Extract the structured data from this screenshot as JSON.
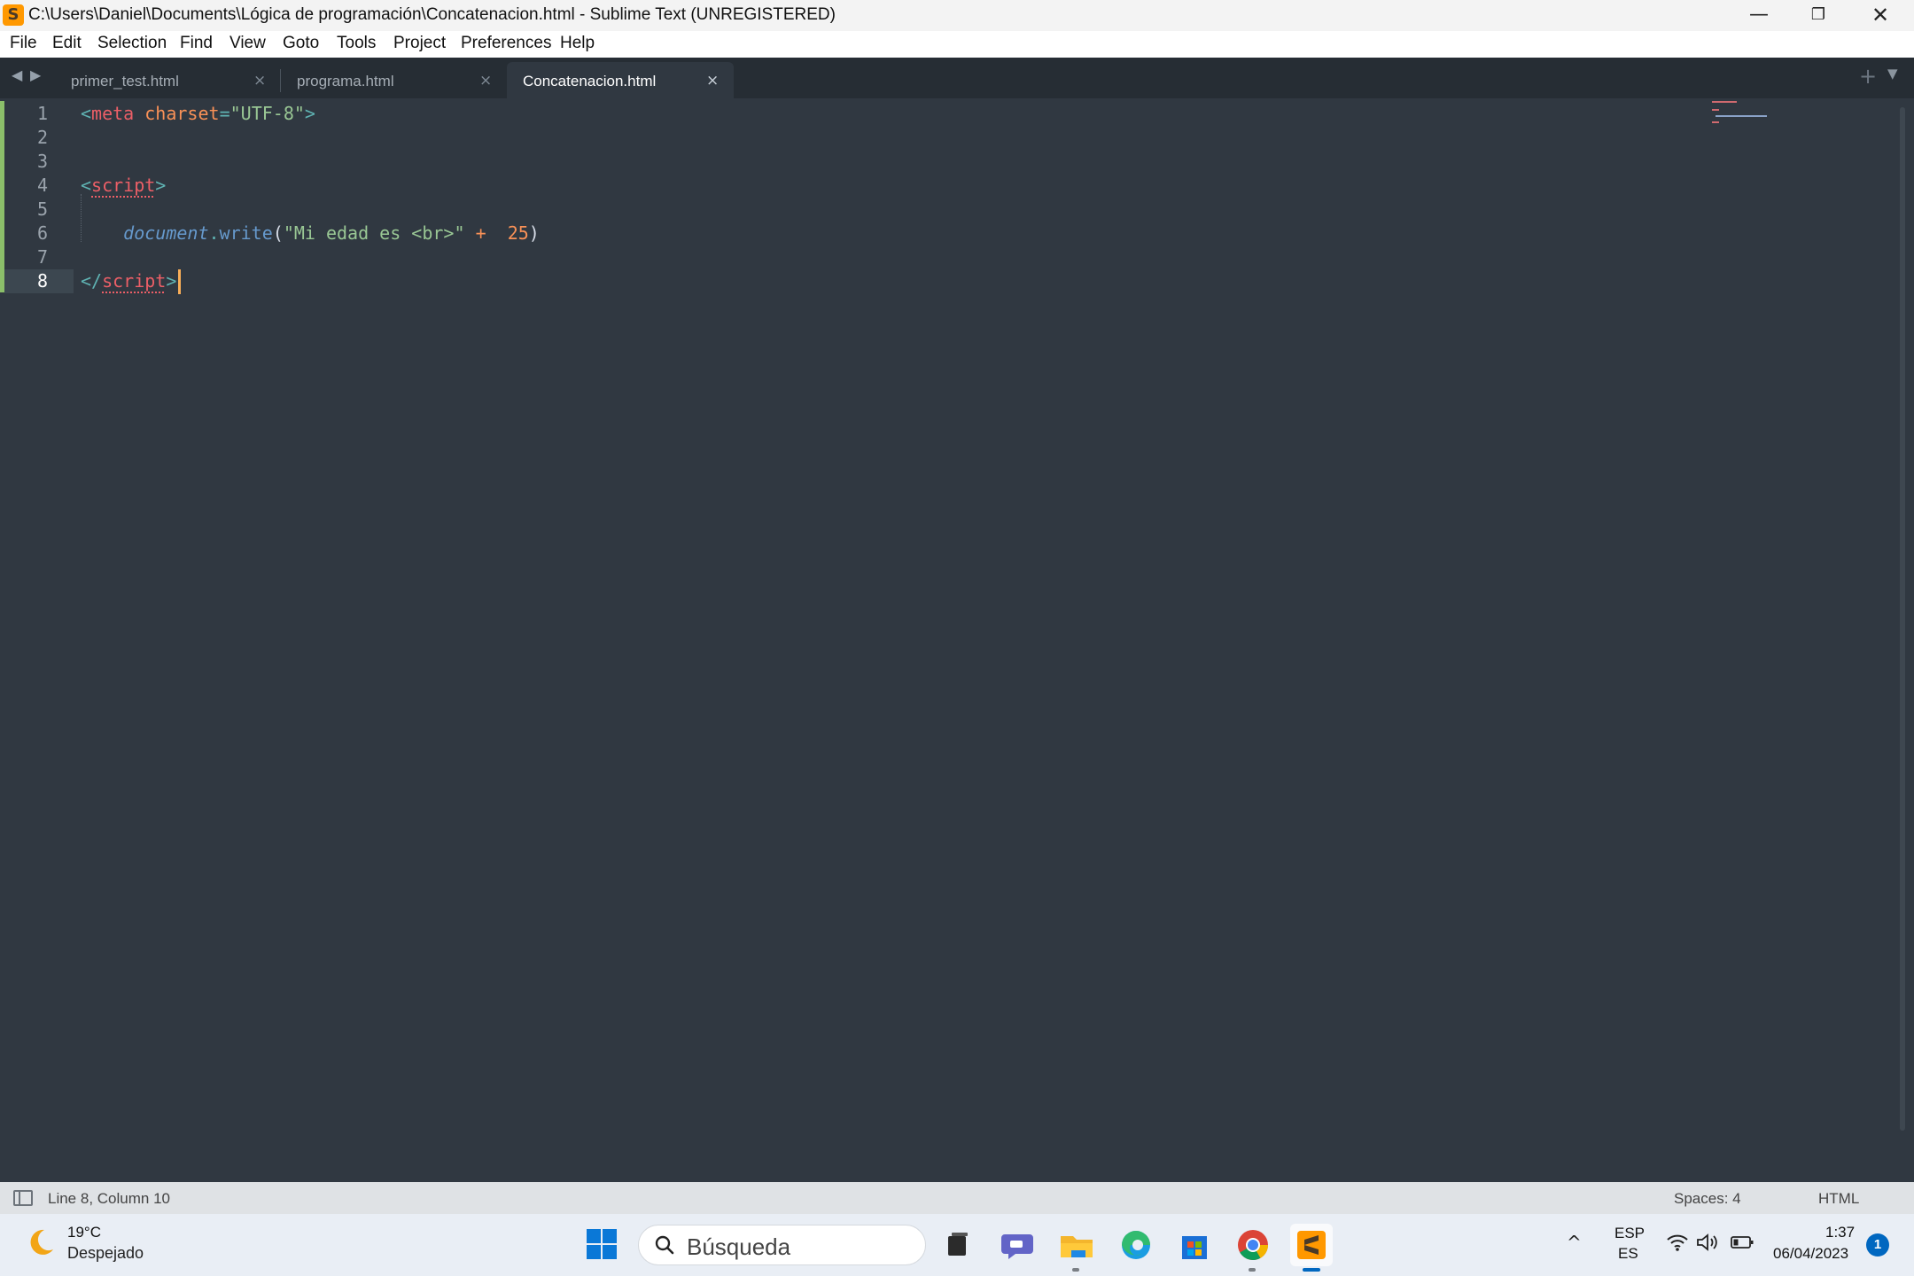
{
  "window": {
    "title": "C:\\Users\\Daniel\\Documents\\Lógica de programación\\Concatenacion.html - Sublime Text (UNREGISTERED)",
    "app_icon": "sublime-text-icon",
    "controls": {
      "minimize": "—",
      "maximize": "❐",
      "close": "✕"
    }
  },
  "menubar": {
    "items": [
      "File",
      "Edit",
      "Selection",
      "Find",
      "View",
      "Goto",
      "Tools",
      "Project",
      "Preferences",
      "Help"
    ]
  },
  "tabs": {
    "nav_back": "◀",
    "nav_forward": "▶",
    "items": [
      {
        "label": "primer_test.html",
        "active": false,
        "close": "×"
      },
      {
        "label": "programa.html",
        "active": false,
        "close": "×"
      },
      {
        "label": "Concatenacion.html",
        "active": true,
        "close": "×"
      }
    ],
    "new_tab": "+",
    "tab_menu": "▼"
  },
  "editor": {
    "language": "HTML",
    "line_numbers": [
      "1",
      "2",
      "3",
      "4",
      "5",
      "6",
      "7",
      "8"
    ],
    "current_line": 8,
    "lines": [
      [
        {
          "t": "<",
          "c": "punc"
        },
        {
          "t": "meta",
          "c": "tag"
        },
        {
          "t": " ",
          "c": "plain"
        },
        {
          "t": "charset",
          "c": "attr"
        },
        {
          "t": "=",
          "c": "punc"
        },
        {
          "t": "\"UTF-8\"",
          "c": "str"
        },
        {
          "t": ">",
          "c": "punc"
        }
      ],
      [],
      [],
      [
        {
          "t": "<",
          "c": "punc"
        },
        {
          "t": "script",
          "c": "tag",
          "squiggle": true
        },
        {
          "t": ">",
          "c": "punc"
        }
      ],
      [],
      [
        {
          "t": "    ",
          "c": "plain"
        },
        {
          "t": "document",
          "c": "obj"
        },
        {
          "t": ".",
          "c": "punc"
        },
        {
          "t": "write",
          "c": "method"
        },
        {
          "t": "(",
          "c": "plain"
        },
        {
          "t": "\"Mi edad es <br>\"",
          "c": "str"
        },
        {
          "t": " ",
          "c": "plain"
        },
        {
          "t": "+",
          "c": "attr"
        },
        {
          "t": "  ",
          "c": "plain"
        },
        {
          "t": "25",
          "c": "num"
        },
        {
          "t": ")",
          "c": "plain"
        }
      ],
      [],
      [
        {
          "t": "</",
          "c": "punc"
        },
        {
          "t": "script",
          "c": "tag",
          "squiggle": true
        },
        {
          "t": ">",
          "c": "punc"
        }
      ]
    ],
    "colors": {
      "background": "#303841",
      "punc": "#5fb3b3",
      "tag": "#ec5f67",
      "attr": "#f99157",
      "str": "#99c794",
      "obj": "#6699cc",
      "num": "#f99157",
      "caret": "#f9ae58",
      "gutter_modified": "#8bbf6a"
    }
  },
  "statusbar": {
    "position": "Line 8, Column 10",
    "indentation": "Spaces: 4",
    "syntax": "HTML"
  },
  "taskbar": {
    "weather": {
      "icon": "moon-icon",
      "temperature": "19°C",
      "condition": "Despejado"
    },
    "search_placeholder": "Búsqueda",
    "apps": [
      "file-explorer-icon",
      "teams-chat-icon",
      "files-folder-icon",
      "edge-icon",
      "microsoft-store-icon",
      "chrome-icon",
      "sublime-text-icon"
    ],
    "tray": {
      "chevron": "^",
      "language": "ESP",
      "layout": "ES",
      "icons": [
        "wifi-icon",
        "volume-icon",
        "battery-icon"
      ]
    },
    "clock": {
      "time": "1:37",
      "date": "06/04/2023"
    },
    "notifications": "1",
    "accent": "#0067c0"
  }
}
